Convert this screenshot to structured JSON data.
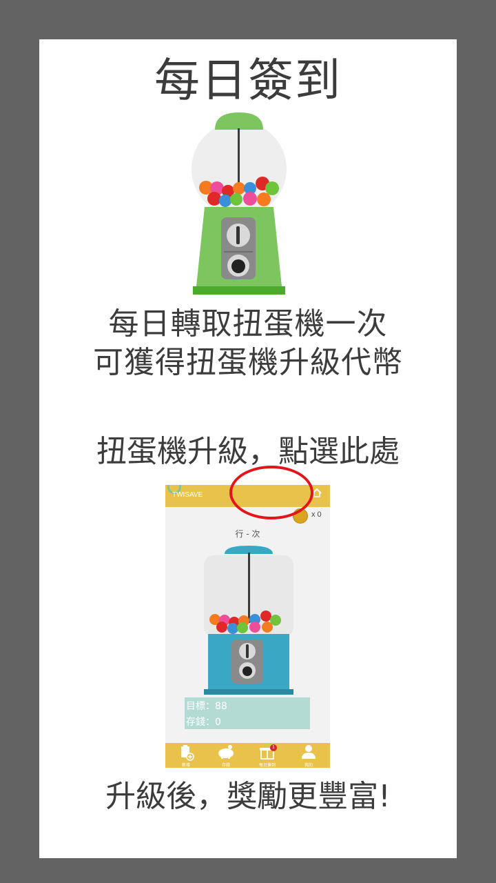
{
  "page": {
    "title": "每日簽到",
    "description_lines": [
      "每日轉取扭蛋機一次",
      "可獲得扭蛋機升級代幣"
    ],
    "hint": "扭蛋機升級，點選此處",
    "reward": "升級後，獎勵更豐富!"
  },
  "preview": {
    "app_name": "TWISAVE",
    "coin_count": "x 0",
    "caption": "行 - 次",
    "goal": "目標：88",
    "saved": "存錢：0",
    "tabs": [
      {
        "label": "新增",
        "icon": "add-record-icon"
      },
      {
        "label": "存錢",
        "icon": "piggy-bank-icon"
      },
      {
        "label": "每日簽到",
        "icon": "gift-icon",
        "badge": "1"
      },
      {
        "label": "我的",
        "icon": "person-icon"
      }
    ]
  },
  "colors": {
    "background": "#636363",
    "card": "#ffffff",
    "machine_green": "#7cc55f",
    "machine_blue": "#3aa8c5",
    "accent_yellow": "#e8c24a",
    "highlight_red": "#e3151a"
  }
}
